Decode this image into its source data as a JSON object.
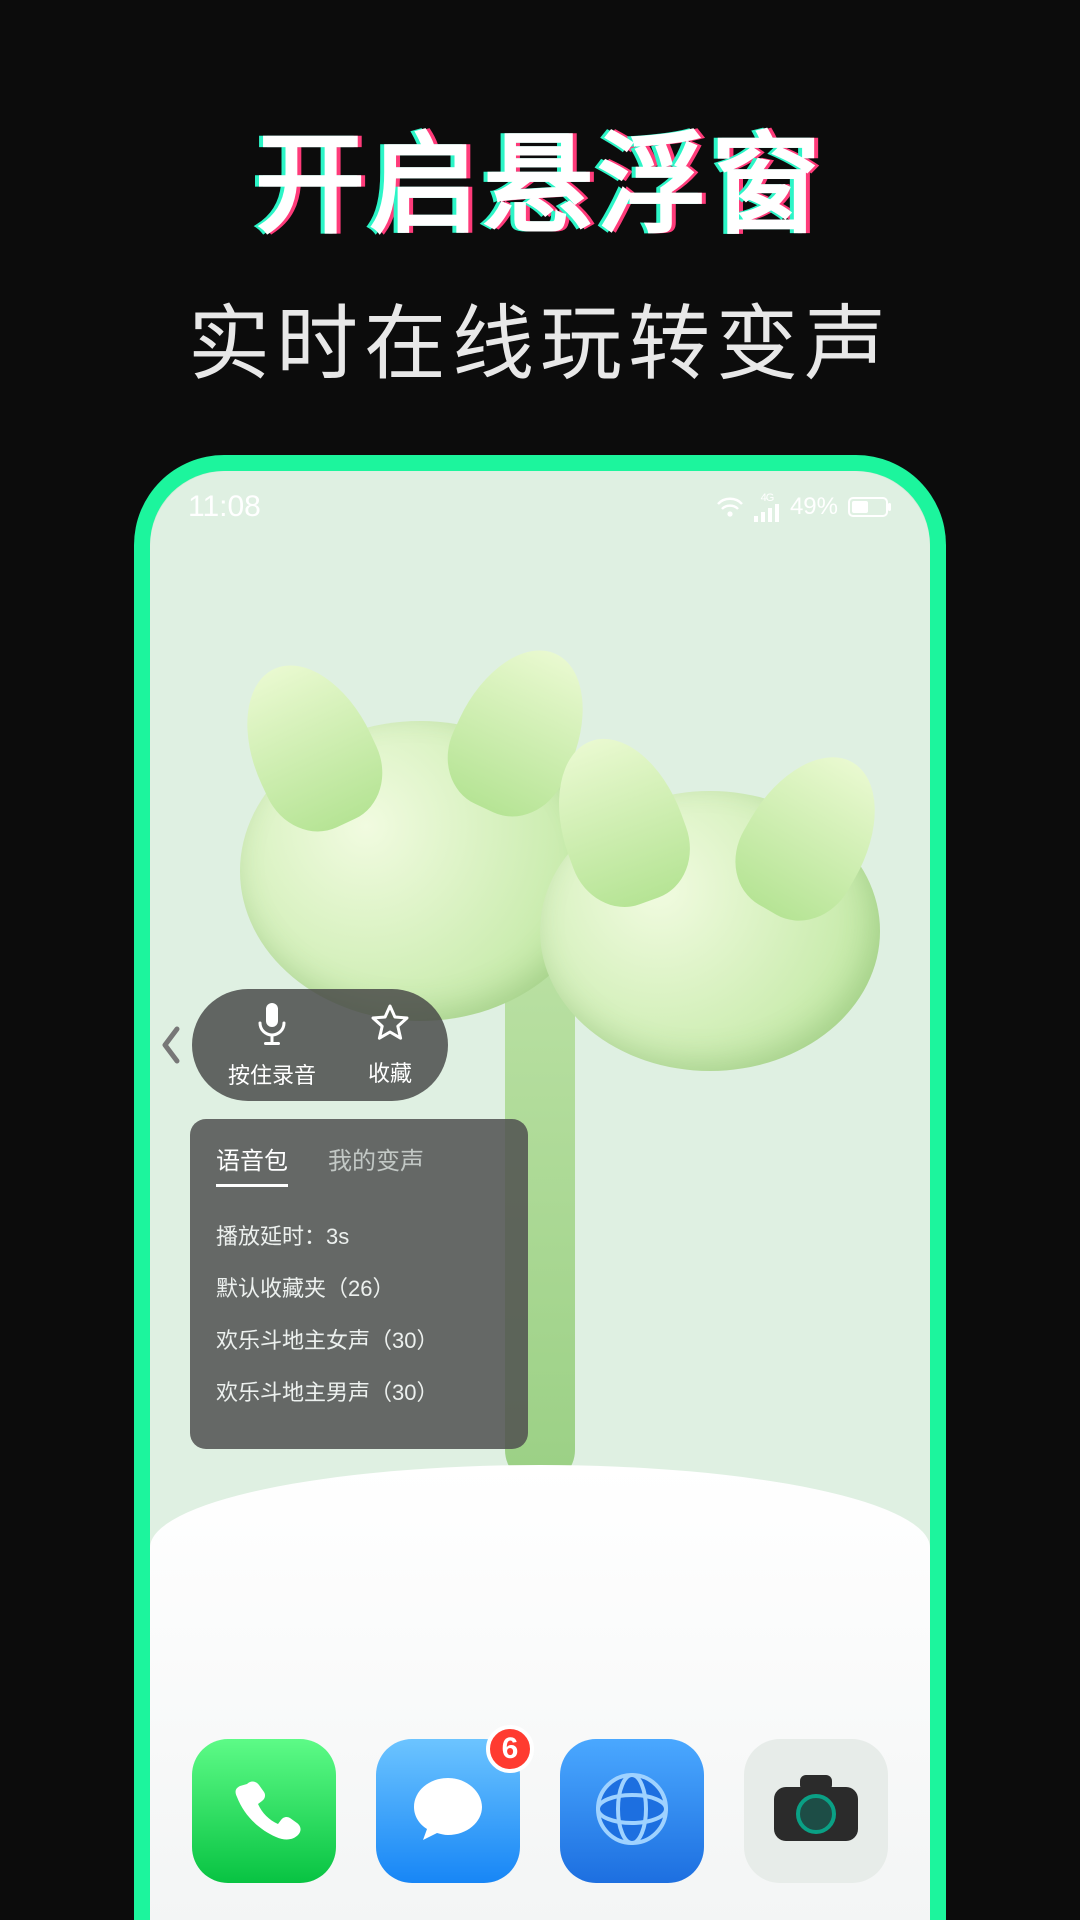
{
  "headline": {
    "title": "开启悬浮窗",
    "subtitle": "实时在线玩转变声"
  },
  "statusbar": {
    "time": "11:08",
    "battery_text": "49%",
    "network": "4G"
  },
  "float_widget": {
    "record_label": "按住录音",
    "fav_label": "收藏"
  },
  "float_panel": {
    "tabs": [
      "语音包",
      "我的变声"
    ],
    "active_tab": 0,
    "items": [
      "播放延时：3s",
      "默认收藏夹（26）",
      "欢乐斗地主女声（30）",
      "欢乐斗地主男声（30）"
    ]
  },
  "dock": {
    "msg_badge": "6"
  }
}
